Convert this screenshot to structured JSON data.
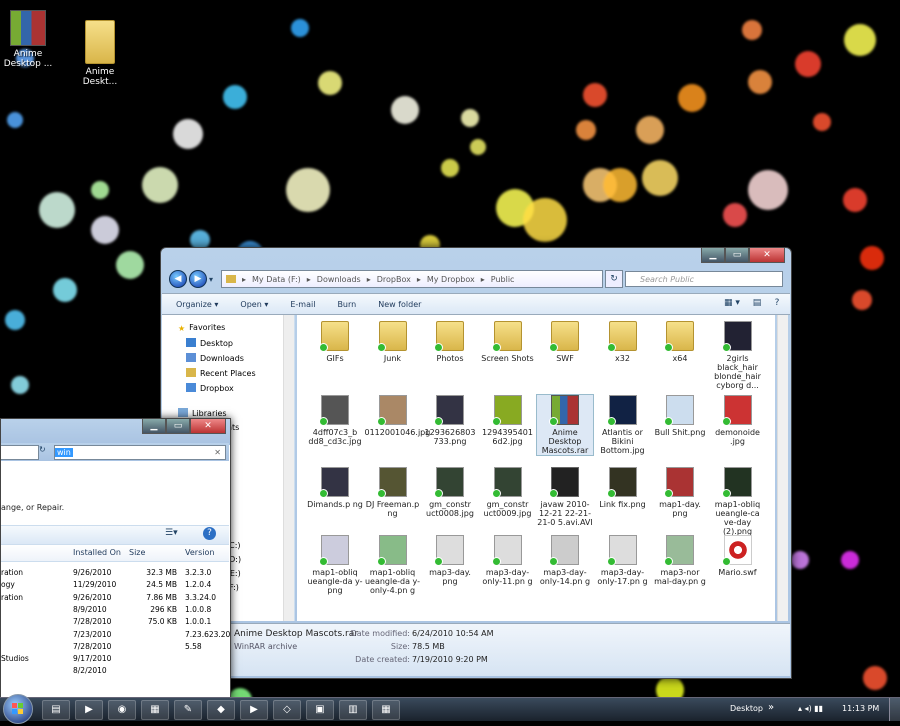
{
  "desktop": {
    "icons": [
      {
        "label": "Anime Desktop ...",
        "icon": "winrar-archive-icon"
      },
      {
        "label": "Anime Deskt...",
        "icon": "folder-icon"
      }
    ]
  },
  "explorer": {
    "window_buttons": {
      "minimize": "▁",
      "maximize": "▭",
      "close": "✕"
    },
    "nav": {
      "back": "◀",
      "forward": "▶",
      "recent": "▾"
    },
    "breadcrumb": [
      "My Data (F:)",
      "Downloads",
      "DropBox",
      "My Dropbox",
      "Public"
    ],
    "breadcrumb_sep": "▸",
    "refresh": "↻",
    "search_placeholder": "Search Public",
    "toolbar": {
      "organize": "Organize ▾",
      "open": "Open ▾",
      "email": "E-mail",
      "burn": "Burn",
      "new_folder": "New folder",
      "views": "▦ ▾",
      "preview": "▤",
      "help": "?"
    },
    "navpane": {
      "favorites": "Favorites",
      "desktop": "Desktop",
      "downloads": "Downloads",
      "recent": "Recent Places",
      "dropbox": "Dropbox",
      "libraries": "Libraries",
      "partial": [
        "ents",
        "(C:)",
        "(D:)",
        "s (E:)",
        "(F:)"
      ]
    },
    "files": [
      {
        "name": "GIFs",
        "type": "folder"
      },
      {
        "name": "Junk",
        "type": "folder"
      },
      {
        "name": "Photos",
        "type": "folder"
      },
      {
        "name": "Screen Shots",
        "type": "folder"
      },
      {
        "name": "SWF",
        "type": "folder"
      },
      {
        "name": "x32",
        "type": "folder"
      },
      {
        "name": "x64",
        "type": "folder"
      },
      {
        "name": "2girls black_hair blonde_hair cyborg d...",
        "type": "image"
      },
      {
        "name": "4dff07c3_b dd8_cd3c.jpg",
        "type": "image"
      },
      {
        "name": "0112001046.jpg",
        "type": "image"
      },
      {
        "name": "1293626803 733.png",
        "type": "image"
      },
      {
        "name": "1294395401 6d2.jpg",
        "type": "image"
      },
      {
        "name": "Anime Desktop Mascots.rar",
        "type": "rar"
      },
      {
        "name": "Atlantis or Bikini Bottom.jpg",
        "type": "image"
      },
      {
        "name": "Bull Shit.png",
        "type": "image"
      },
      {
        "name": "demonoide .jpg",
        "type": "image"
      },
      {
        "name": "Dimands.p ng",
        "type": "image"
      },
      {
        "name": "DJ Freeman.p ng",
        "type": "image"
      },
      {
        "name": "gm_constr uct0008.jpg",
        "type": "image"
      },
      {
        "name": "gm_constr uct0009.jpg",
        "type": "image"
      },
      {
        "name": "javaw 2010-12-21 22-21-21-0 5.avi.AVI",
        "type": "video"
      },
      {
        "name": "Link fix.png",
        "type": "image"
      },
      {
        "name": "map1-day. png",
        "type": "image"
      },
      {
        "name": "map1-obliq ueangle-ca ve-day (2).png",
        "type": "image"
      },
      {
        "name": "map1-obliq ueangle-da y-png",
        "type": "image"
      },
      {
        "name": "map1-obliq ueangle-da y-only-4.pn g",
        "type": "image"
      },
      {
        "name": "map3-day. png",
        "type": "image"
      },
      {
        "name": "map3-day- only-11.pn g",
        "type": "image"
      },
      {
        "name": "map3-day- only-14.pn g",
        "type": "image"
      },
      {
        "name": "map3-day- only-17.pn g",
        "type": "image"
      },
      {
        "name": "map3-nor mal-day.pn g",
        "type": "image"
      },
      {
        "name": "Mario.swf",
        "type": "swf"
      }
    ],
    "details": {
      "name": "Anime Desktop Mascots.rar",
      "kind": "WinRAR archive",
      "modified_label": "Date modified:",
      "modified": "6/24/2010 10:54 AM",
      "size_label": "Size:",
      "size": "78.5 MB",
      "created_label": "Date created:",
      "created": "7/19/2010 9:20 PM"
    }
  },
  "programs": {
    "window_buttons": {
      "minimize": "▁",
      "maximize": "▭",
      "close": "✕"
    },
    "search_value": "win",
    "search_clear": "✕",
    "dropdown": "▾",
    "description": "ange, or Repair.",
    "columns": {
      "installed": "Installed On",
      "size": "Size",
      "version": "Version"
    },
    "rows": [
      {
        "name": "ration",
        "installed": "9/26/2010",
        "size": "32.3 MB",
        "version": "3.2.3.0"
      },
      {
        "name": "ogy",
        "installed": "11/29/2010",
        "size": "24.5 MB",
        "version": "1.2.0.4"
      },
      {
        "name": "ration",
        "installed": "9/26/2010",
        "size": "7.86 MB",
        "version": "3.3.24.0"
      },
      {
        "name": "",
        "installed": "8/9/2010",
        "size": "296 KB",
        "version": "1.0.0.8"
      },
      {
        "name": "",
        "installed": "7/28/2010",
        "size": "75.0 KB",
        "version": "1.0.0.1"
      },
      {
        "name": "",
        "installed": "7/23/2010",
        "size": "",
        "version": "7.23.623.20"
      },
      {
        "name": "",
        "installed": "7/28/2010",
        "size": "",
        "version": "5.58"
      },
      {
        "name": "Studios",
        "installed": "9/17/2010",
        "size": "",
        "version": ""
      },
      {
        "name": "",
        "installed": "8/2/2010",
        "size": "",
        "version": ""
      }
    ]
  },
  "taskbar": {
    "buttons": [
      "▤",
      "▶",
      "◉",
      "▦",
      "✎",
      "◆",
      "▶",
      "◇",
      "▣",
      "▥",
      "▦"
    ],
    "desktop_label": "Desktop",
    "desktop_arrows": "»",
    "tray_icons": "▴ ◂) ▮▮",
    "time": "11:13 PM"
  }
}
